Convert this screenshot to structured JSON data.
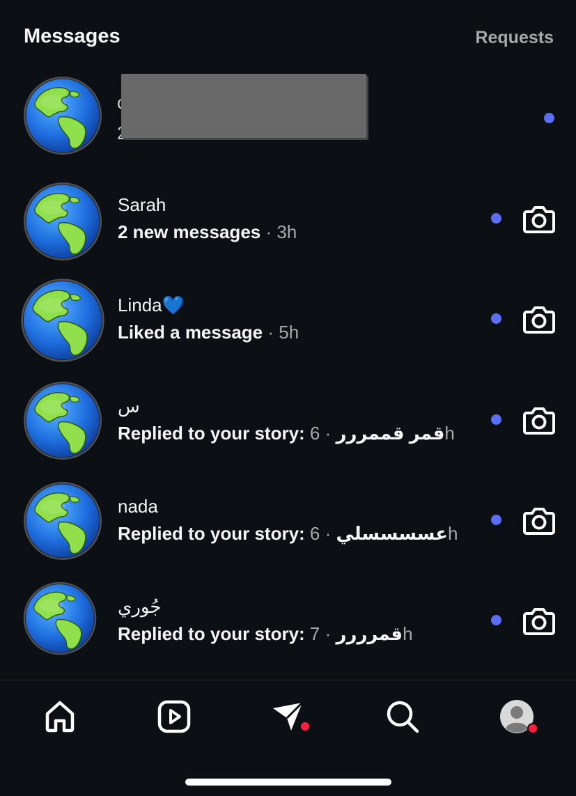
{
  "header": {
    "title": "Messages",
    "requests_label": "Requests"
  },
  "threads": [
    {
      "name": "",
      "message": "",
      "time": "",
      "unread": true,
      "has_camera": false,
      "redacted": true
    },
    {
      "name": "Sarah",
      "message": "2 new messages",
      "time": "· 3h",
      "unread": true,
      "has_camera": true
    },
    {
      "name": "Linda💙",
      "message": "Liked a message",
      "time": "· 5h",
      "unread": true,
      "has_camera": true
    },
    {
      "name": "س",
      "message": "Replied to your story: قمر قممررر",
      "time": "· 6h",
      "unread": true,
      "has_camera": true
    },
    {
      "name": "nada",
      "message": "Replied to your story: عسسسسلي",
      "time": "· 6h",
      "unread": true,
      "has_camera": true
    },
    {
      "name": "جُوري",
      "message": "Replied to your story: قمرررر",
      "time": "· 7h",
      "unread": true,
      "has_camera": true
    }
  ],
  "icons": {
    "avatar": "globe-icon",
    "camera": "camera-icon",
    "unread": "unread-dot"
  },
  "colors": {
    "unread_dot": "#5b6ef7",
    "notification_badge": "#ff1f3d",
    "background": "#0c1014"
  },
  "nav": [
    {
      "icon": "home-icon",
      "badge": false
    },
    {
      "icon": "reels-icon",
      "badge": false
    },
    {
      "icon": "direct-messages-icon",
      "badge": true
    },
    {
      "icon": "search-icon",
      "badge": false
    },
    {
      "icon": "profile-icon",
      "badge": true
    }
  ]
}
